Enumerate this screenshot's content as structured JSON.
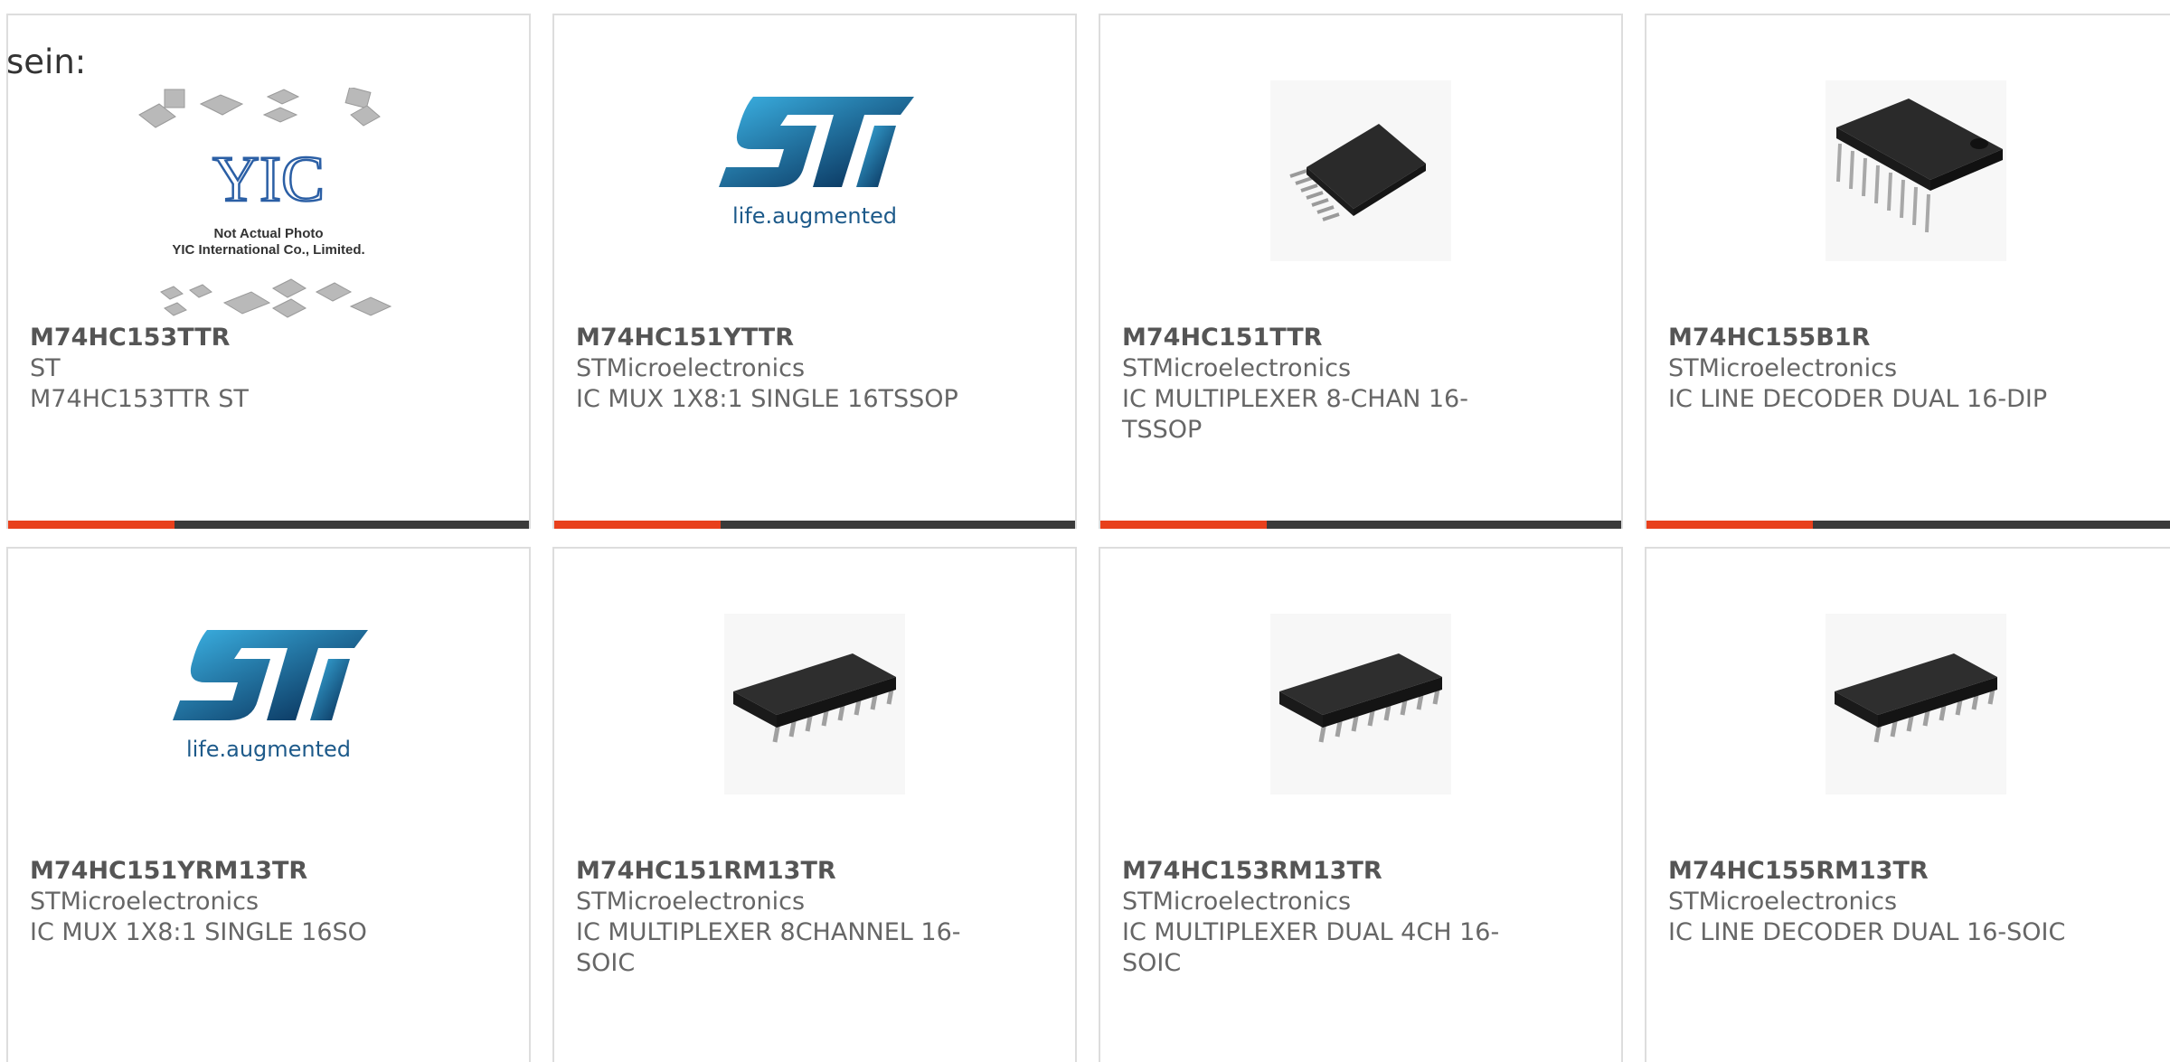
{
  "intro_text": "sein:",
  "colors": {
    "accent": "#e8401c",
    "bar": "#3a3a3a",
    "border": "#dddddd",
    "text": "#666666"
  },
  "products": [
    {
      "part": "M74HC153TTR",
      "manufacturer": "ST",
      "description": "M74HC153TTR ST",
      "image": "placeholder-photo",
      "image_text": {
        "line1": "Not Actual Photo",
        "line2": "YIC International Co., Limited.",
        "logo": "YIC"
      }
    },
    {
      "part": "M74HC151YTTR",
      "manufacturer": "STMicroelectronics",
      "description": "IC MUX 1X8:1 SINGLE 16TSSOP",
      "image": "st-logo",
      "image_text": {
        "tagline": "life.augmented"
      }
    },
    {
      "part": "M74HC151TTR",
      "manufacturer": "STMicroelectronics",
      "description": "IC MULTIPLEXER 8-CHAN 16-TSSOP",
      "image": "tssop-chip"
    },
    {
      "part": "M74HC155B1R",
      "manufacturer": "STMicroelectronics",
      "description": "IC LINE DECODER DUAL 16-DIP",
      "image": "dip-chip"
    },
    {
      "part": "M74HC151YRM13TR",
      "manufacturer": "STMicroelectronics",
      "description": "IC MUX 1X8:1 SINGLE 16SO",
      "image": "st-logo",
      "image_text": {
        "tagline": "life.augmented"
      }
    },
    {
      "part": "M74HC151RM13TR",
      "manufacturer": "STMicroelectronics",
      "description": "IC MULTIPLEXER 8CHANNEL 16-SOIC",
      "image": "soic-chip"
    },
    {
      "part": "M74HC153RM13TR",
      "manufacturer": "STMicroelectronics",
      "description": "IC MULTIPLEXER DUAL 4CH 16-SOIC",
      "image": "soic-chip"
    },
    {
      "part": "M74HC155RM13TR",
      "manufacturer": "STMicroelectronics",
      "description": "IC LINE DECODER DUAL 16-SOIC",
      "image": "soic-chip"
    }
  ]
}
